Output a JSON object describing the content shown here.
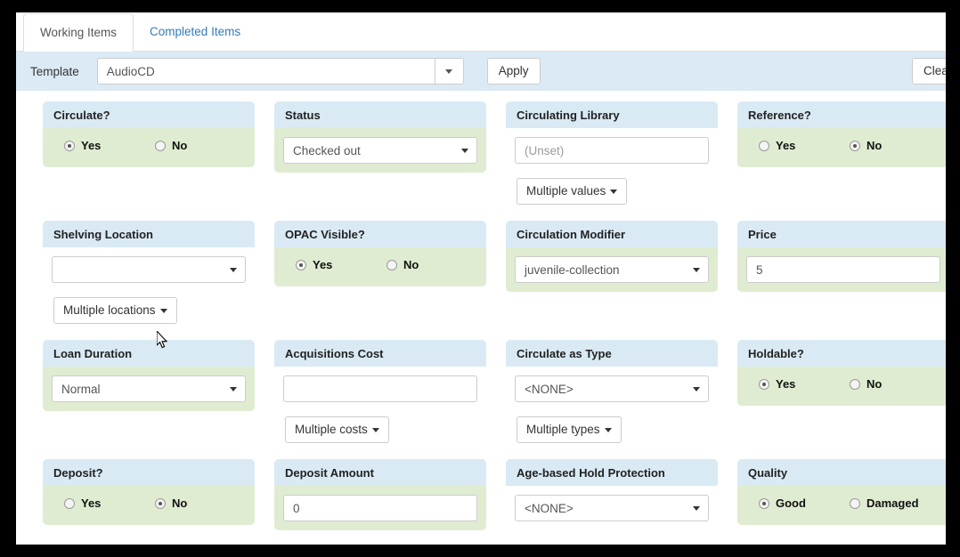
{
  "tabs": [
    {
      "label": "Working Items",
      "active": true
    },
    {
      "label": "Completed Items",
      "active": false
    }
  ],
  "template_bar": {
    "label": "Template",
    "value": "AudioCD",
    "apply_label": "Apply",
    "clear_label": "Clear"
  },
  "cards": [
    {
      "title": "Circulate?",
      "body": "green",
      "control": "radio",
      "options": [
        {
          "label": "Yes",
          "selected": true
        },
        {
          "label": "No",
          "selected": false
        }
      ]
    },
    {
      "title": "Status",
      "body": "green",
      "control": "select",
      "value": "Checked out"
    },
    {
      "title": "Circulating Library",
      "body": "white",
      "control": "input",
      "value": "",
      "placeholder": "(Unset)",
      "under_button": "Multiple values"
    },
    {
      "title": "Reference?",
      "body": "green",
      "control": "radio",
      "options": [
        {
          "label": "Yes",
          "selected": false
        },
        {
          "label": "No",
          "selected": true
        }
      ]
    },
    {
      "title": "Shelving Location",
      "body": "white",
      "control": "select",
      "value": "",
      "under_button": "Multiple locations"
    },
    {
      "title": "OPAC Visible?",
      "body": "green",
      "control": "radio",
      "options": [
        {
          "label": "Yes",
          "selected": true
        },
        {
          "label": "No",
          "selected": false
        }
      ]
    },
    {
      "title": "Circulation Modifier",
      "body": "green",
      "control": "select",
      "value": "juvenile-collection"
    },
    {
      "title": "Price",
      "body": "green",
      "control": "input",
      "value": "5",
      "placeholder": ""
    },
    {
      "title": "Loan Duration",
      "body": "green",
      "control": "select",
      "value": "Normal"
    },
    {
      "title": "Acquisitions Cost",
      "body": "white",
      "control": "input",
      "value": "",
      "placeholder": "",
      "under_button": "Multiple costs"
    },
    {
      "title": "Circulate as Type",
      "body": "white",
      "control": "select",
      "value": "<NONE>",
      "under_button": "Multiple types"
    },
    {
      "title": "Holdable?",
      "body": "green",
      "control": "radio",
      "options": [
        {
          "label": "Yes",
          "selected": true
        },
        {
          "label": "No",
          "selected": false
        }
      ]
    },
    {
      "title": "Deposit?",
      "body": "green",
      "control": "radio",
      "options": [
        {
          "label": "Yes",
          "selected": false
        },
        {
          "label": "No",
          "selected": true
        }
      ]
    },
    {
      "title": "Deposit Amount",
      "body": "green",
      "control": "input",
      "value": "0",
      "placeholder": ""
    },
    {
      "title": "Age-based Hold Protection",
      "body": "white",
      "control": "select",
      "value": "<NONE>"
    },
    {
      "title": "Quality",
      "body": "green",
      "control": "radio",
      "options": [
        {
          "label": "Good",
          "selected": true
        },
        {
          "label": "Damaged",
          "selected": false
        }
      ]
    }
  ],
  "colors": {
    "card_header": "#d9eaf4",
    "card_body_green": "#dfecd1",
    "template_bar": "#dbeaf5",
    "tab_link": "#337ab7"
  }
}
